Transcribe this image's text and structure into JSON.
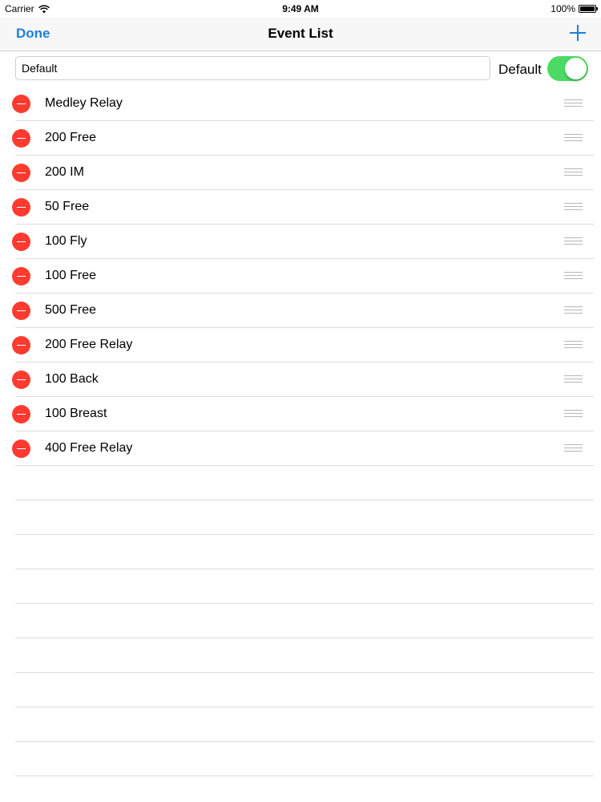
{
  "status_bar": {
    "carrier": "Carrier",
    "time": "9:49 AM",
    "battery_text": "100%",
    "battery_level": 1.0
  },
  "nav_bar": {
    "done_label": "Done",
    "title": "Event List",
    "add_icon": "plus-icon"
  },
  "header": {
    "name_value": "Default",
    "default_label": "Default",
    "default_switch_on": true
  },
  "events": [
    {
      "label": "Medley Relay"
    },
    {
      "label": "200 Free"
    },
    {
      "label": "200 IM"
    },
    {
      "label": "50 Free"
    },
    {
      "label": "100 Fly"
    },
    {
      "label": "100 Free"
    },
    {
      "label": "500 Free"
    },
    {
      "label": "200 Free Relay"
    },
    {
      "label": "100 Back"
    },
    {
      "label": "100 Breast"
    },
    {
      "label": "400 Free Relay"
    }
  ],
  "colors": {
    "accent": "#1f7fdb",
    "delete": "#ff3b30",
    "switch_on": "#4cd964"
  }
}
